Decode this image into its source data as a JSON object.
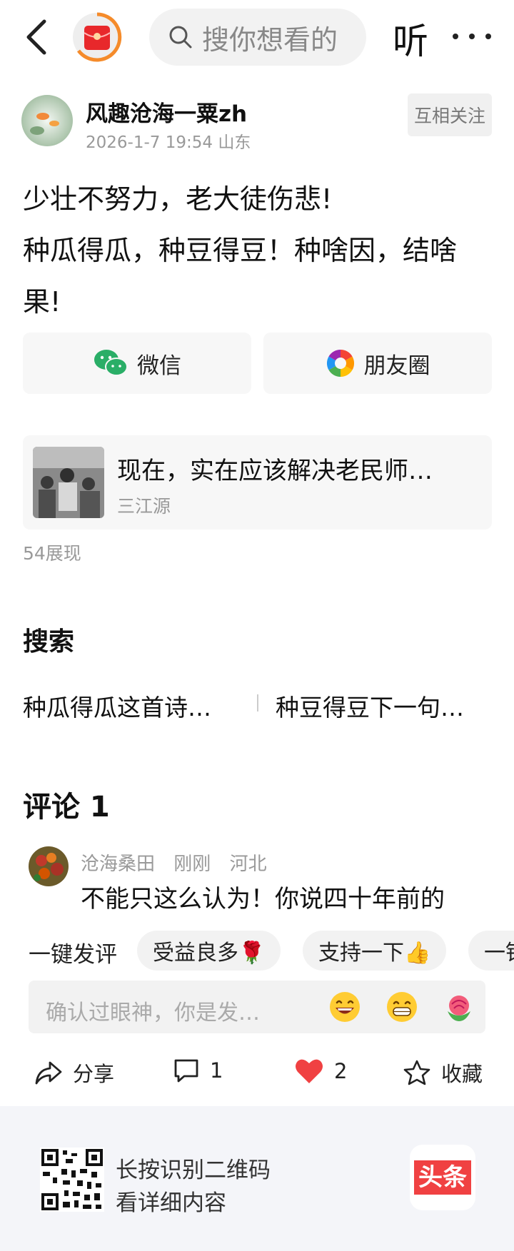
{
  "header": {
    "search_placeholder": "搜你想看的",
    "listen_label": "听",
    "icons": [
      "back-arrow-icon",
      "red-envelope-icon",
      "search-icon",
      "more-icon"
    ]
  },
  "author": {
    "name": "风趣沧海一粟zh",
    "datetime": "2026-1-7 19:54",
    "location": "山东",
    "follow_label": "互相关注"
  },
  "post": {
    "lines": [
      "少壮不努力，老大徒伤悲!",
      "种瓜得瓜，种豆得豆！种啥因，结啥果!"
    ]
  },
  "share": {
    "wechat_label": "微信",
    "moments_label": "朋友圈"
  },
  "linked_article": {
    "title": "现在，实在应该解决老民师…",
    "source": "三江源"
  },
  "impressions": "54展现",
  "search_section": {
    "title": "搜索",
    "suggestions": [
      "种瓜得瓜这首诗…",
      "种豆得豆下一句…"
    ]
  },
  "comments": {
    "title": "评论 1",
    "items": [
      {
        "user": "沧海桑田",
        "time": "刚刚",
        "location": "河北",
        "text": "不能只这么认为！你说四十年前的"
      }
    ]
  },
  "quick_reply": {
    "label": "一键发评",
    "chips": [
      "受益良多🌹",
      "支持一下👍",
      "一针"
    ]
  },
  "comment_input": {
    "placeholder": "确认过眼神，你是发…",
    "emojis": [
      "grinning-emoji",
      "beaming-emoji",
      "rose-emoji"
    ]
  },
  "actions": {
    "share_label": "分享",
    "comment_count": "1",
    "like_count": "2",
    "favorite_label": "收藏",
    "like_color": "#f04142"
  },
  "footer": {
    "line1": "长按识别二维码",
    "line2": "看详细内容",
    "brand": "头条",
    "brand_color": "#f04142"
  }
}
